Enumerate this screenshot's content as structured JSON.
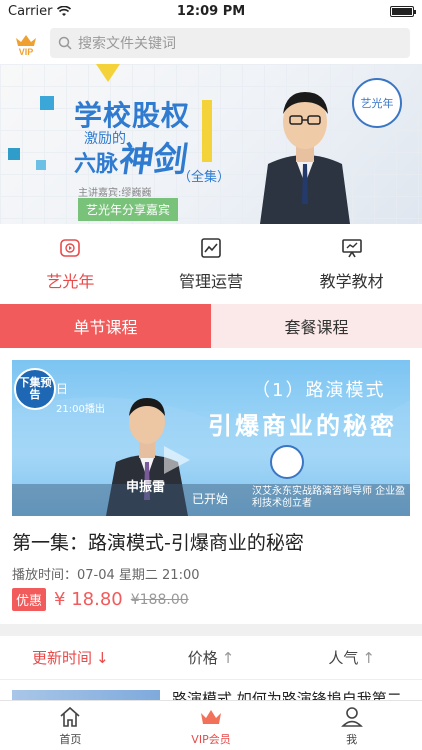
{
  "status_bar": {
    "carrier": "Carrier",
    "time": "12:09 PM"
  },
  "search": {
    "placeholder": "搜索文件关键词",
    "vip_label": "VIP"
  },
  "banner": {
    "title": "学校股权",
    "sub1": "激励的",
    "sub2": "六脉",
    "big": "神剑",
    "quan": "（全集）",
    "guest": "主讲嘉宾:缪巍巍",
    "share": "艺光年分享嘉宾",
    "logo_text": "艺光年"
  },
  "categories": [
    {
      "label": "艺光年",
      "icon": "play-circle-icon"
    },
    {
      "label": "管理运营",
      "icon": "chart-icon"
    },
    {
      "label": "教学教材",
      "icon": "presentation-icon"
    }
  ],
  "segments": {
    "single": "单节课程",
    "package": "套餐课程"
  },
  "course": {
    "video": {
      "next_badge": "下集预告",
      "date": "日",
      "time": "21:00播出",
      "title1": "（1）路演模式",
      "title2": "引爆商业的秘密",
      "presenter": "申振雷",
      "started": "已开始",
      "slogan": "汉艾永东实战路演咨询导师 企业盈利技术创立者"
    },
    "title": "第一集：路演模式-引爆商业的秘密",
    "air_time": "播放时间：07-04 星期二 21:00",
    "badge": "优惠",
    "price": "¥ 18.80",
    "old_price": "¥188.00"
  },
  "sort": [
    {
      "label": "更新时间",
      "arrow": "↓"
    },
    {
      "label": "价格",
      "arrow": "↑"
    },
    {
      "label": "人气",
      "arrow": "↑"
    }
  ],
  "list_peek": {
    "text": "路演模式 如何为路演锋埠自我第二"
  },
  "tabbar": [
    {
      "label": "首页",
      "icon": "home-icon"
    },
    {
      "label": "VIP会员",
      "icon": "crown-icon"
    },
    {
      "label": "我",
      "icon": "user-icon"
    }
  ],
  "colors": {
    "accent": "#f25b5b",
    "banner_blue": "#2f7bd0"
  }
}
